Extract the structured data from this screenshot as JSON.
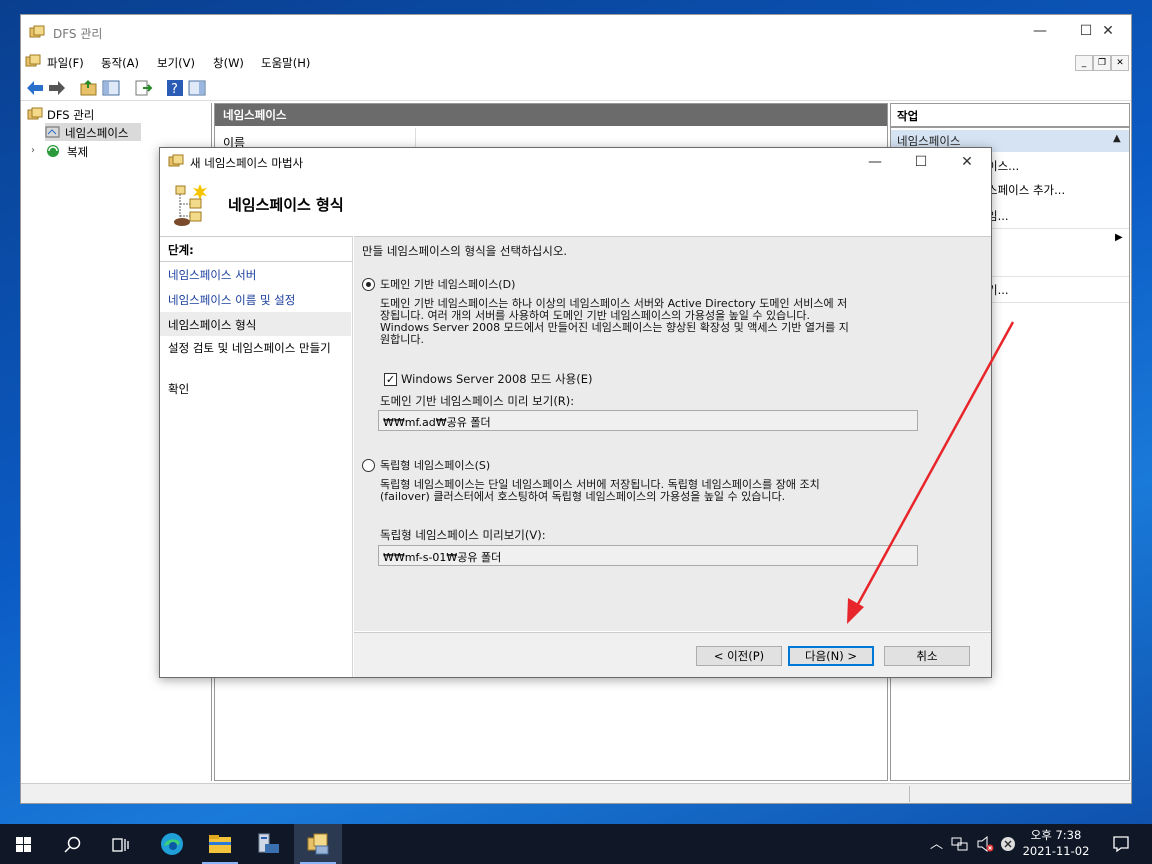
{
  "mmc": {
    "title": "DFS 관리",
    "menu": [
      "파일(F)",
      "동작(A)",
      "보기(V)",
      "창(W)",
      "도움말(H)"
    ],
    "tree": {
      "root": "DFS 관리",
      "namespaces": "네임스페이스",
      "replication": "복제"
    },
    "center": {
      "header": "네임스페이스",
      "column_name": "이름"
    },
    "actions": {
      "header": "작업",
      "section": "네임스페이스",
      "items": [
        "이스...",
        "스페이스 추가...",
        "임..."
      ],
      "help_fragment": "기..."
    }
  },
  "wizard": {
    "title": "새 네임스페이스 마법사",
    "heading": "네임스페이스 형식",
    "steps_header": "단계:",
    "steps": [
      "네임스페이스 서버",
      "네임스페이스 이름 및 설정",
      "네임스페이스 형식",
      "설정 검토 및 네임스페이스 만들기",
      "확인"
    ],
    "current_step_index": 2,
    "instruction": "만들 네임스페이스의 형식을 선택하십시오.",
    "domain_option": {
      "label": "도메인 기반 네임스페이스(D)",
      "selected": true,
      "description_lines": [
        "도메인 기반 네임스페이스는 하나 이상의 네임스페이스 서버와 Active Directory 도메인 서비스에 저",
        "장됩니다. 여러 개의 서버를 사용하여 도메인 기반 네임스페이스의 가용성을 높일 수 있습니다.",
        "Windows Server 2008 모드에서 만들어진 네임스페이스는 향상된 확장성 및 액세스 기반 열거를 지",
        "원합니다."
      ],
      "checkbox_label": "Windows Server 2008 모드 사용(E)",
      "checkbox_checked": true,
      "preview_label": "도메인 기반 네임스페이스 미리 보기(R):",
      "preview_value": "₩₩mf.ad₩공유 폴더"
    },
    "standalone_option": {
      "label": "독립형 네임스페이스(S)",
      "selected": false,
      "description_lines": [
        "독립형 네임스페이스는 단일 네임스페이스 서버에 저장됩니다. 독립형 네임스페이스를 장애 조치",
        "(failover) 클러스터에서 호스팅하여 독립형 네임스페이스의 가용성을 높일 수 있습니다."
      ],
      "preview_label": "독립형 네임스페이스 미리보기(V):",
      "preview_value": "₩₩mf-s-01₩공유 폴더"
    },
    "buttons": {
      "back": "< 이전(P)",
      "next": "다음(N) >",
      "cancel": "취소"
    }
  },
  "annotation_arrow_color": "#e8252a",
  "taskbar": {
    "time": "오후 7:38",
    "date": "2021-11-02",
    "pinned": [
      "start-icon",
      "search-icon",
      "task-view-icon",
      "edge-icon",
      "file-explorer-icon",
      "server-manager-icon",
      "dfs-management-icon"
    ]
  }
}
